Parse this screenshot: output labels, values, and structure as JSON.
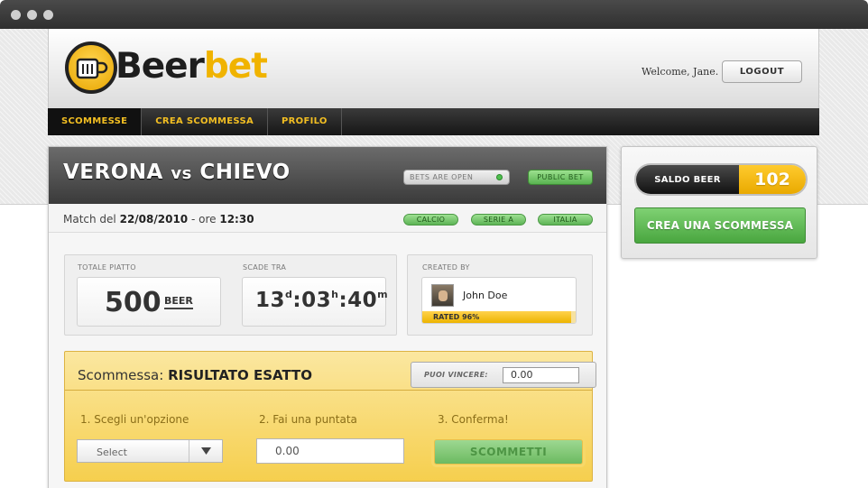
{
  "header": {
    "logo_text_dark": "Beer",
    "logo_text_accent": "bet",
    "welcome": "Welcome, Jane.",
    "logout_label": "LOGOUT"
  },
  "nav": {
    "items": [
      {
        "label": "SCOMMESSE",
        "active": true
      },
      {
        "label": "CREA SCOMMESSA",
        "active": false
      },
      {
        "label": "PROFILO",
        "active": false
      }
    ]
  },
  "match": {
    "home": "VERONA",
    "vs": "vs",
    "away": "CHIEVO",
    "status_pill": "BETS ARE OPEN",
    "visibility_pill": "PUBLIC BET",
    "date_prefix": "Match del",
    "date": "22/08/2010",
    "time_prefix": "- ore",
    "time": "12:30",
    "tags": [
      "CALCIO",
      "SERIE A",
      "ITALIA"
    ]
  },
  "stats": {
    "pot_label": "TOTALE PIATTO",
    "pot_value": "500",
    "pot_unit": "BEER",
    "expires_label": "SCADE TRA",
    "expires_days": "13",
    "expires_days_unit": "d",
    "expires_hours": "03",
    "expires_hours_unit": "h",
    "expires_minutes": "40",
    "expires_minutes_unit": "m",
    "creator_label": "CREATED BY",
    "creator_name": "John Doe",
    "rating_text": "RATED 96%",
    "rating_fraction": 0.96
  },
  "bet": {
    "title_prefix": "Scommessa:",
    "title": "RISULTATO ESATTO",
    "win_label": "PUOI VINCERE:",
    "win_value": "0.00",
    "step1": "1. Scegli un'opzione",
    "step2": "2. Fai una puntata",
    "step3": "3. Conferma!",
    "select_value": "Select",
    "stake_value": "0.00",
    "submit_label": "SCOMMETTI"
  },
  "side": {
    "saldo_label": "SALDO BEER",
    "saldo_value": "102",
    "create_label": "CREA UNA SCOMMESSA"
  },
  "colors": {
    "accent_yellow": "#f0b300",
    "accent_green": "#5ab351",
    "nav_text": "#f2be22"
  }
}
